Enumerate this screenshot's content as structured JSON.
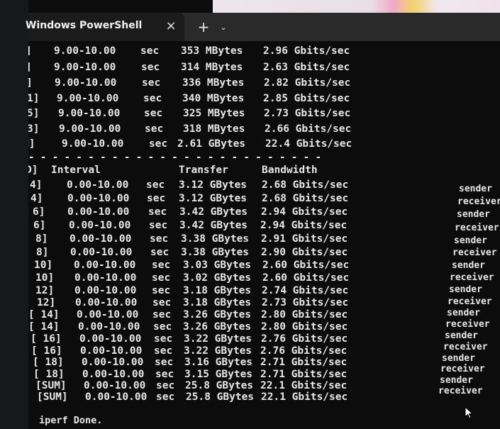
{
  "window": {
    "tab_title": "Windows PowerShell",
    "close_symbol": "×",
    "new_tab_symbol": "+",
    "dropdown_symbol": "⌄"
  },
  "interval_rows": [
    {
      "id": "]",
      "interval": "9.00-10.00",
      "unit": "sec",
      "transfer": "353 MBytes",
      "bandwidth": "2.96 Gbits/sec"
    },
    {
      "id": "]",
      "interval": "9.00-10.00",
      "unit": "sec",
      "transfer": "314 MBytes",
      "bandwidth": "2.63 Gbits/sec"
    },
    {
      "id": "]",
      "interval": "9.00-10.00",
      "unit": "sec",
      "transfer": "336 MBytes",
      "bandwidth": "2.82 Gbits/sec"
    },
    {
      "id": "1]",
      "interval": "9.00-10.00",
      "unit": "sec",
      "transfer": "340 MBytes",
      "bandwidth": "2.85 Gbits/sec"
    },
    {
      "id": "5]",
      "interval": "9.00-10.00",
      "unit": "sec",
      "transfer": "325 MBytes",
      "bandwidth": "2.73 Gbits/sec"
    },
    {
      "id": "3]",
      "interval": "9.00-10.00",
      "unit": "sec",
      "transfer": "318 MBytes",
      "bandwidth": "2.66 Gbits/sec"
    },
    {
      "id": "M]",
      "interval": "9.00-10.00",
      "unit": "sec",
      "transfer": "2.61 GBytes",
      "bandwidth": "22.4 Gbits/sec"
    }
  ],
  "separator": "- - - - - - - - - - - - - - - - - - - - - - - - -",
  "summary_header": {
    "id": "D]",
    "interval": "Interval",
    "transfer": "Transfer",
    "bandwidth": "Bandwidth"
  },
  "summary_rows": [
    {
      "id": "4]",
      "interval": "0.00-10.00",
      "unit": "sec",
      "transfer": "3.12 GBytes",
      "bandwidth": "2.68 Gbits/sec",
      "role": "sender"
    },
    {
      "id": "4]",
      "interval": "0.00-10.00",
      "unit": "sec",
      "transfer": "3.12 GBytes",
      "bandwidth": "2.68 Gbits/sec",
      "role": "receiver"
    },
    {
      "id": "6]",
      "interval": "0.00-10.00",
      "unit": "sec",
      "transfer": "3.42 GBytes",
      "bandwidth": "2.94 Gbits/sec",
      "role": "sender"
    },
    {
      "id": "6]",
      "interval": "0.00-10.00",
      "unit": "sec",
      "transfer": "3.42 GBytes",
      "bandwidth": "2.94 Gbits/sec",
      "role": "receiver"
    },
    {
      "id": "8]",
      "interval": "0.00-10.00",
      "unit": "sec",
      "transfer": "3.38 GBytes",
      "bandwidth": "2.91 Gbits/sec",
      "role": "sender"
    },
    {
      "id": "8]",
      "interval": "0.00-10.00",
      "unit": "sec",
      "transfer": "3.38 GBytes",
      "bandwidth": "2.90 Gbits/sec",
      "role": "receiver"
    },
    {
      "id": "10]",
      "interval": "0.00-10.00",
      "unit": "sec",
      "transfer": "3.03 GBytes",
      "bandwidth": "2.60 Gbits/sec",
      "role": "sender"
    },
    {
      "id": "10]",
      "interval": "0.00-10.00",
      "unit": "sec",
      "transfer": "3.02 GBytes",
      "bandwidth": "2.60 Gbits/sec",
      "role": "receiver"
    },
    {
      "id": "12]",
      "interval": "0.00-10.00",
      "unit": "sec",
      "transfer": "3.18 GBytes",
      "bandwidth": "2.74 Gbits/sec",
      "role": "sender"
    },
    {
      "id": "12]",
      "interval": "0.00-10.00",
      "unit": "sec",
      "transfer": "3.18 GBytes",
      "bandwidth": "2.73 Gbits/sec",
      "role": "receiver"
    },
    {
      "id": "[ 14]",
      "interval": "0.00-10.00",
      "unit": "sec",
      "transfer": "3.26 GBytes",
      "bandwidth": "2.80 Gbits/sec",
      "role": "sender"
    },
    {
      "id": "[ 14]",
      "interval": "0.00-10.00",
      "unit": "sec",
      "transfer": "3.26 GBytes",
      "bandwidth": "2.80 Gbits/sec",
      "role": "receiver"
    },
    {
      "id": "[ 16]",
      "interval": "0.00-10.00",
      "unit": "sec",
      "transfer": "3.22 GBytes",
      "bandwidth": "2.76 Gbits/sec",
      "role": "sender"
    },
    {
      "id": "[ 16]",
      "interval": "0.00-10.00",
      "unit": "sec",
      "transfer": "3.22 GBytes",
      "bandwidth": "2.76 Gbits/sec",
      "role": "receiver"
    },
    {
      "id": "[ 18]",
      "interval": "0.00-10.00",
      "unit": "sec",
      "transfer": "3.16 GBytes",
      "bandwidth": "2.71 Gbits/sec",
      "role": "sender"
    },
    {
      "id": "[ 18]",
      "interval": "0.00-10.00",
      "unit": "sec",
      "transfer": "3.15 GBytes",
      "bandwidth": "2.71 Gbits/sec",
      "role": "receiver"
    },
    {
      "id": "[SUM]",
      "interval": "0.00-10.00",
      "unit": "sec",
      "transfer": "25.8 GBytes",
      "bandwidth": "22.1 Gbits/sec",
      "role": "sender"
    },
    {
      "id": "[SUM]",
      "interval": "0.00-10.00",
      "unit": "sec",
      "transfer": "25.8 GBytes",
      "bandwidth": "22.1 Gbits/sec",
      "role": "receiver"
    }
  ],
  "footer_text": "iperf Done.",
  "icons": {
    "close": "close-icon",
    "new_tab": "plus-icon",
    "dropdown": "chevron-down-icon",
    "cursor": "mouse-cursor-icon"
  },
  "colors": {
    "terminal_bg": "#0c0c0c",
    "text": "#e8e8e8",
    "tab_bar": "#2a2a2a",
    "active_tab": "#1b1b1b"
  }
}
